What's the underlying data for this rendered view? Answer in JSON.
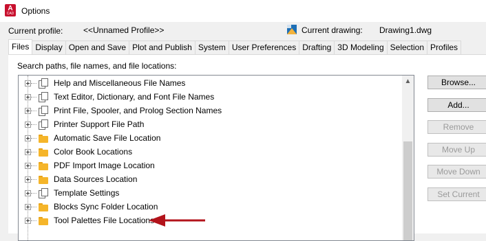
{
  "window": {
    "app_icon_letter": "A",
    "app_icon_caption": "CAD",
    "title": "Options"
  },
  "profile": {
    "current_profile_label": "Current profile:",
    "current_profile_value": "<<Unnamed Profile>>",
    "current_drawing_label": "Current drawing:",
    "current_drawing_value": "Drawing1.dwg"
  },
  "tabs": [
    {
      "label": "Files",
      "active": true
    },
    {
      "label": "Display"
    },
    {
      "label": "Open and Save"
    },
    {
      "label": "Plot and Publish"
    },
    {
      "label": "System"
    },
    {
      "label": "User Preferences"
    },
    {
      "label": "Drafting"
    },
    {
      "label": "3D Modeling"
    },
    {
      "label": "Selection"
    },
    {
      "label": "Profiles"
    }
  ],
  "files_panel": {
    "label": "Search paths, file names, and file locations:",
    "tree_items": [
      {
        "label": "Help and Miscellaneous File Names",
        "icon": "documents-icon"
      },
      {
        "label": "Text Editor, Dictionary, and Font File Names",
        "icon": "documents-icon"
      },
      {
        "label": "Print File, Spooler, and Prolog Section Names",
        "icon": "documents-icon"
      },
      {
        "label": "Printer Support File Path",
        "icon": "documents-icon"
      },
      {
        "label": "Automatic Save File Location",
        "icon": "folder-icon"
      },
      {
        "label": "Color Book Locations",
        "icon": "folder-icon"
      },
      {
        "label": "PDF Import Image Location",
        "icon": "folder-icon"
      },
      {
        "label": "Data Sources Location",
        "icon": "folder-icon"
      },
      {
        "label": "Template Settings",
        "icon": "documents-icon"
      },
      {
        "label": "Blocks Sync Folder Location",
        "icon": "folder-icon"
      },
      {
        "label": "Tool Palettes File Locations",
        "icon": "folder-icon"
      }
    ]
  },
  "side_buttons": {
    "browse": "Browse...",
    "add": "Add...",
    "remove": "Remove",
    "move_up": "Move Up",
    "move_down": "Move Down",
    "set_current": "Set Current"
  },
  "colors": {
    "accent_arrow": "#b3131b",
    "app_icon": "#c8102e",
    "folder": "#f5b52a"
  }
}
